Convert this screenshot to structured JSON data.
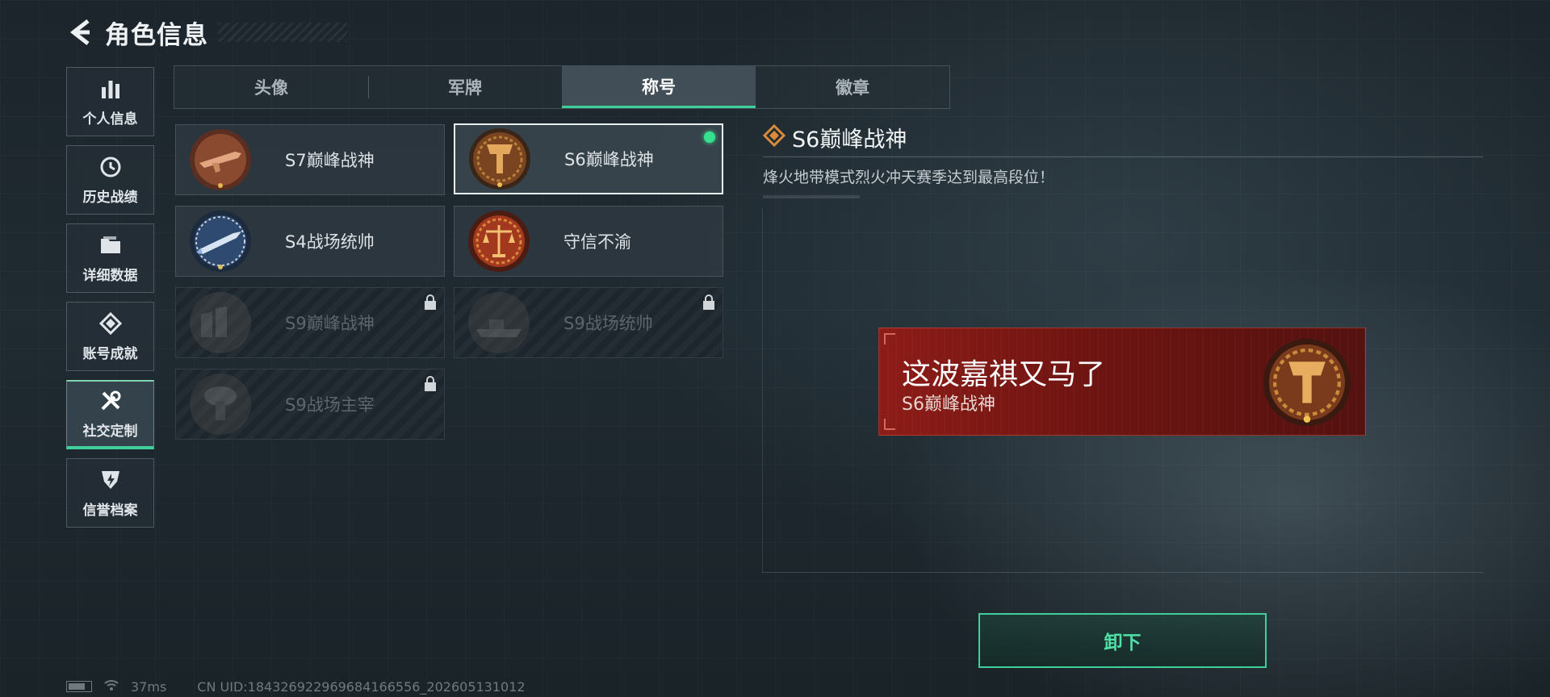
{
  "header": {
    "title": "角色信息"
  },
  "sidebar": {
    "items": [
      {
        "label": "个人信息",
        "icon": "bar-chart-icon"
      },
      {
        "label": "历史战绩",
        "icon": "history-clock-icon"
      },
      {
        "label": "详细数据",
        "icon": "folder-icon"
      },
      {
        "label": "账号成就",
        "icon": "achievement-icon"
      },
      {
        "label": "社交定制",
        "icon": "tools-icon",
        "active": true
      },
      {
        "label": "信誉档案",
        "icon": "shield-icon"
      }
    ]
  },
  "tabs": [
    {
      "label": "头像"
    },
    {
      "label": "军牌"
    },
    {
      "label": "称号",
      "active": true
    },
    {
      "label": "徽章"
    }
  ],
  "titles": [
    {
      "label": "S7巅峰战神",
      "emblem": "rifle-emblem",
      "locked": false
    },
    {
      "label": "S6巅峰战神",
      "emblem": "t-shield-emblem",
      "locked": false,
      "selected": true,
      "equipped": true
    },
    {
      "label": "S4战场统帅",
      "emblem": "missile-emblem",
      "locked": false
    },
    {
      "label": "守信不渝",
      "emblem": "scales-emblem",
      "locked": false
    },
    {
      "label": "S9巅峰战神",
      "emblem": "fortress-emblem",
      "locked": true
    },
    {
      "label": "S9战场统帅",
      "emblem": "warship-emblem",
      "locked": true
    },
    {
      "label": "S9战场主宰",
      "emblem": "mushroom-cloud-emblem",
      "locked": true
    }
  ],
  "detail": {
    "title": "S6巅峰战神",
    "description": "烽火地带模式烈火冲天赛季达到最高段位！"
  },
  "preview": {
    "player_name": "这波嘉祺又马了",
    "title": "S6巅峰战神"
  },
  "action": {
    "unequip_label": "卸下"
  },
  "footer": {
    "ping": "37ms",
    "uid": "CN UID:184326922969684166556_202605131012"
  },
  "colors": {
    "accent": "#3fcf9a",
    "banner": "#8d1c17",
    "gold": "#c99a4a"
  }
}
